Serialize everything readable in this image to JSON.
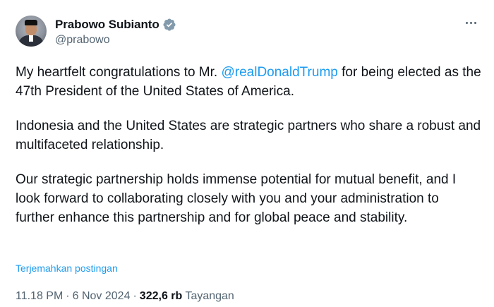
{
  "author": {
    "name": "Prabowo Subianto",
    "handle": "@prabowo",
    "verified_icon": "verified-badge-icon",
    "verified_color": "#829aab"
  },
  "tweet": {
    "p1_before": "My heartfelt congratulations to Mr. ",
    "mention": "@realDonaldTrump",
    "p1_after": " for being elected as the 47th President of the United States of America.",
    "p2": "Indonesia and the United States are strategic partners who share a robust and multifaceted relationship.",
    "p3": "Our strategic partnership holds immense potential for mutual benefit, and I look forward to collaborating closely with you and your administration to further enhance this partnership and for global peace and stability."
  },
  "translate_label": "Terjemahkan postingan",
  "meta": {
    "time": "11.18 PM",
    "date": "6 Nov 2024",
    "views_count": "322,6 rb",
    "views_label": "Tayangan",
    "separator": "·"
  },
  "more_icon": "more-horizontal-icon",
  "colors": {
    "link": "#1d9bf0",
    "text": "#0f1419",
    "secondary": "#536471"
  }
}
